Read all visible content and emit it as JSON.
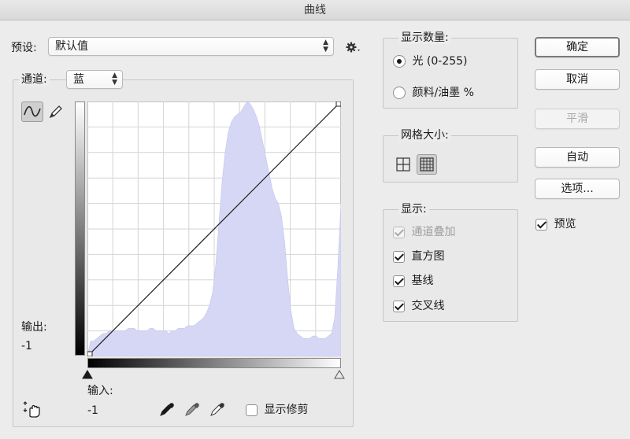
{
  "window": {
    "title": "曲线"
  },
  "preset": {
    "label": "预设:",
    "value": "默认值"
  },
  "channel": {
    "label": "通道:",
    "value": "蓝"
  },
  "output": {
    "label": "输出:",
    "value": "-1"
  },
  "input": {
    "label": "输入:",
    "value": "-1"
  },
  "show_clipping": {
    "label": "显示修剪",
    "checked": false
  },
  "display_amount": {
    "legend": "显示数量:",
    "options": [
      {
        "label": "光 (0-255)",
        "selected": true
      },
      {
        "label": "颜料/油墨 %",
        "selected": false
      }
    ]
  },
  "grid_size": {
    "legend": "网格大小:",
    "selected": "fine"
  },
  "show": {
    "legend": "显示:",
    "items": [
      {
        "label": "通道叠加",
        "checked": true,
        "disabled": true
      },
      {
        "label": "直方图",
        "checked": true,
        "disabled": false
      },
      {
        "label": "基线",
        "checked": true,
        "disabled": false
      },
      {
        "label": "交叉线",
        "checked": true,
        "disabled": false
      }
    ]
  },
  "buttons": {
    "ok": "确定",
    "cancel": "取消",
    "smooth": "平滑",
    "auto": "自动",
    "options": "选项..."
  },
  "preview": {
    "label": "预览",
    "checked": true
  },
  "colors": {
    "histogram": "#d6d6f5",
    "histogram_stroke": "#c4c4ee",
    "curve": "#222222",
    "grid": "#d4d4d4"
  },
  "chart_data": {
    "type": "area",
    "x_range": [
      0,
      255
    ],
    "y_range": [
      0,
      255
    ],
    "curve_points": [
      [
        0,
        0
      ],
      [
        255,
        255
      ]
    ],
    "histogram": [
      0,
      0.06,
      0.06,
      0.07,
      0.08,
      0.09,
      0.09,
      0.1,
      0.1,
      0.1,
      0.1,
      0.1,
      0.1,
      0.11,
      0.11,
      0.11,
      0.1,
      0.1,
      0.1,
      0.1,
      0.11,
      0.11,
      0.1,
      0.1,
      0.1,
      0.1,
      0.09,
      0.1,
      0.1,
      0.11,
      0.11,
      0.11,
      0.12,
      0.12,
      0.12,
      0.13,
      0.14,
      0.15,
      0.17,
      0.2,
      0.25,
      0.36,
      0.52,
      0.68,
      0.8,
      0.88,
      0.92,
      0.94,
      0.95,
      0.96,
      0.98,
      1.0,
      0.99,
      0.97,
      0.94,
      0.9,
      0.84,
      0.78,
      0.72,
      0.66,
      0.62,
      0.6,
      0.55,
      0.45,
      0.3,
      0.18,
      0.11,
      0.09,
      0.08,
      0.07,
      0.07,
      0.07,
      0.08,
      0.08,
      0.07,
      0.07,
      0.07,
      0.08,
      0.09,
      0.15,
      0.35,
      0.6
    ]
  }
}
